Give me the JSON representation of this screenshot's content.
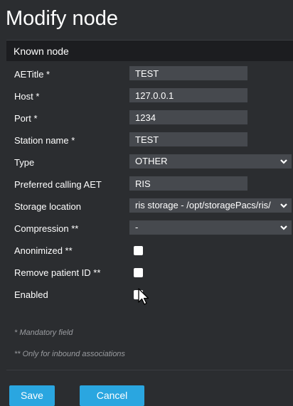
{
  "dialog": {
    "title": "Modify node",
    "section": "Known node"
  },
  "fields": {
    "aetitle": {
      "label": "AETitle *",
      "value": "TEST"
    },
    "host": {
      "label": "Host *",
      "value": "127.0.0.1"
    },
    "port": {
      "label": "Port *",
      "value": "1234"
    },
    "station_name": {
      "label": "Station name *",
      "value": "TEST"
    },
    "type": {
      "label": "Type",
      "value": "OTHER"
    },
    "preferred_calling_aet": {
      "label": "Preferred calling AET",
      "value": "RIS"
    },
    "storage_location": {
      "label": "Storage location",
      "value": "ris storage - /opt/storagePacs/ris/"
    },
    "compression": {
      "label": "Compression **",
      "value": "-"
    },
    "anonimized": {
      "label": "Anonimized **",
      "checked": false
    },
    "remove_patient_id": {
      "label": "Remove patient ID **",
      "checked": false
    },
    "enabled": {
      "label": "Enabled",
      "checked": false
    }
  },
  "notes": {
    "mandatory": "* Mandatory field",
    "inbound": "** Only for inbound associations"
  },
  "buttons": {
    "save": "Save",
    "cancel": "Cancel"
  },
  "colors": {
    "background": "#2b2d30",
    "field": "#46494e",
    "accent": "#2aa6e0"
  }
}
